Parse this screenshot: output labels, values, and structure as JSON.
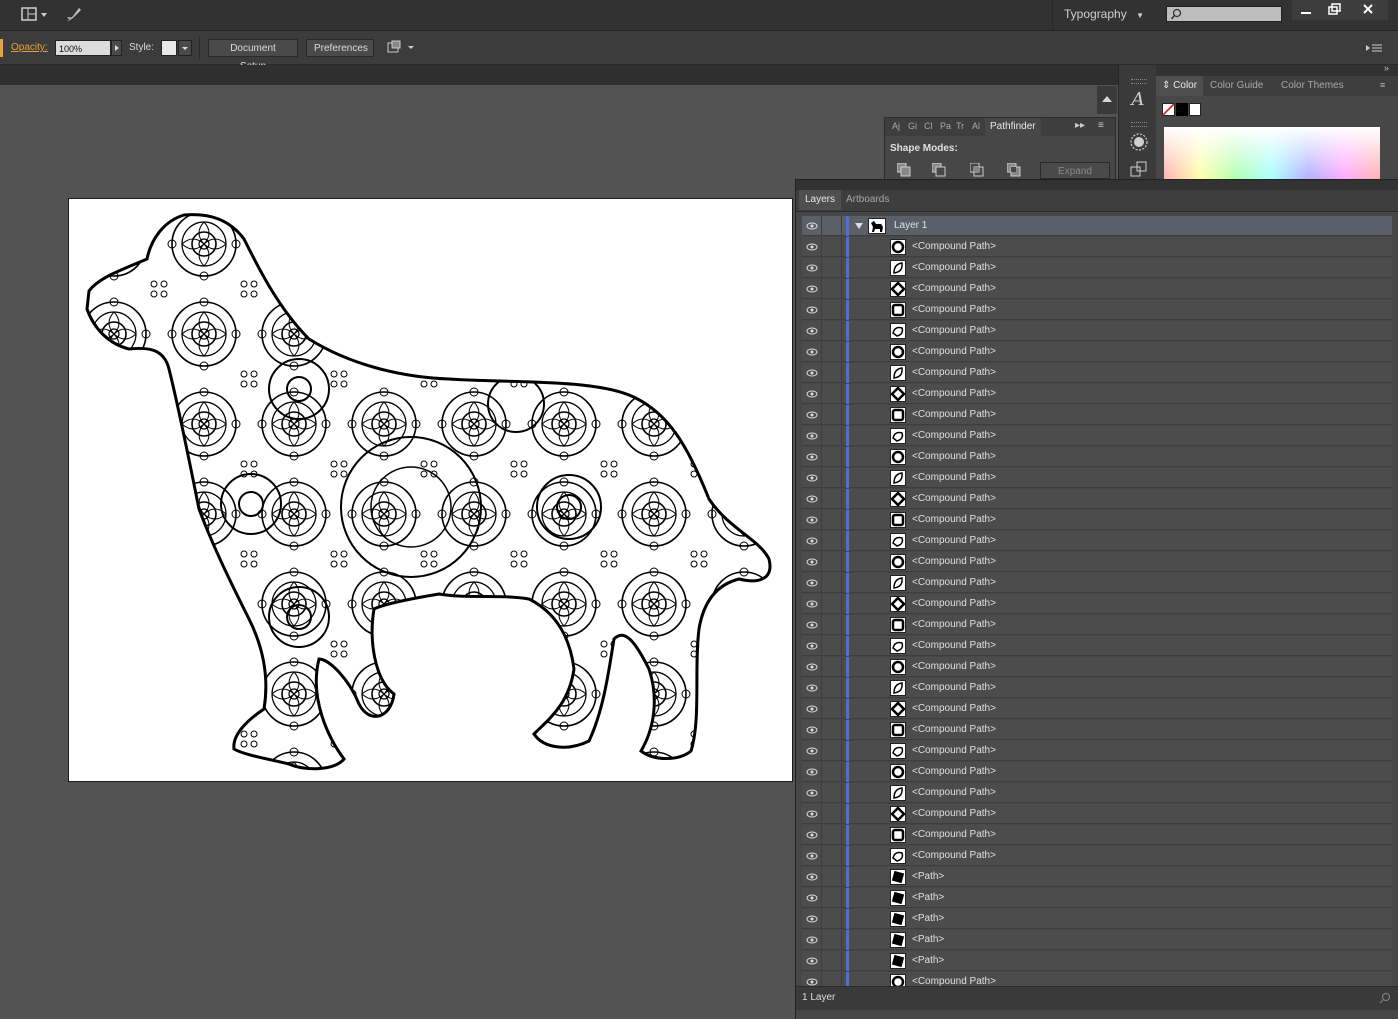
{
  "appbar": {
    "workspace": "Typography",
    "search_placeholder": ""
  },
  "controlbar": {
    "opacity_label": "Opacity:",
    "opacity_value": "100%",
    "style_label": "Style:",
    "document_setup": "Document Setup",
    "preferences": "Preferences"
  },
  "pathfinder": {
    "tabs": [
      "Aj",
      "Gi",
      "Cl",
      "Pa",
      "Tr",
      "Al",
      "Pathfinder"
    ],
    "shape_modes": "Shape Modes:",
    "expand": "Expand"
  },
  "color": {
    "tabs": [
      "Color",
      "Color Guide",
      "Color Themes"
    ]
  },
  "layers": {
    "tabs": [
      "Layers",
      "Artboards"
    ],
    "layer_name": "Layer 1",
    "items": [
      "<Compound Path>",
      "<Compound Path>",
      "<Compound Path>",
      "<Compound Path>",
      "<Compound Path>",
      "<Compound Path>",
      "<Compound Path>",
      "<Compound Path>",
      "<Compound Path>",
      "<Compound Path>",
      "<Compound Path>",
      "<Compound Path>",
      "<Compound Path>",
      "<Compound Path>",
      "<Compound Path>",
      "<Compound Path>",
      "<Compound Path>",
      "<Compound Path>",
      "<Compound Path>",
      "<Compound Path>",
      "<Compound Path>",
      "<Compound Path>",
      "<Compound Path>",
      "<Compound Path>",
      "<Compound Path>",
      "<Compound Path>",
      "<Compound Path>",
      "<Compound Path>",
      "<Compound Path>",
      "<Compound Path>",
      "<Path>",
      "<Path>",
      "<Path>",
      "<Path>",
      "<Path>",
      "<Compound Path>"
    ],
    "footer": "1 Layer"
  },
  "colors": {
    "accent_orange": "#e8a33d",
    "selection_blue": "#4f6fd8"
  }
}
